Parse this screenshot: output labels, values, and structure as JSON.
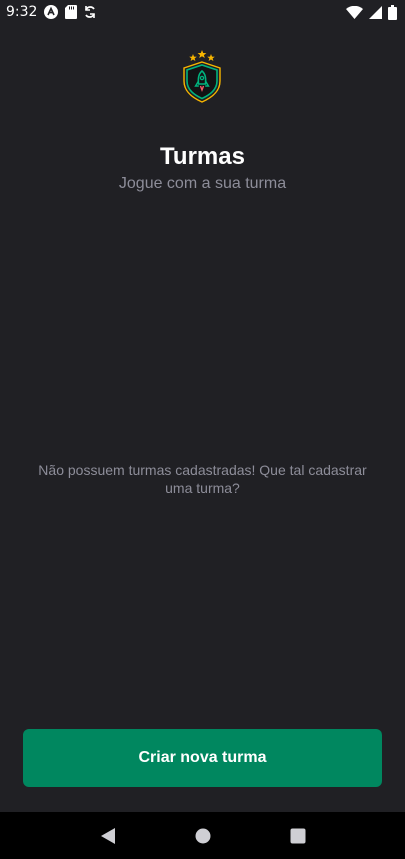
{
  "status_bar": {
    "time": "9:32",
    "icons_left": [
      "app-a-icon",
      "sd-card-icon",
      "sync-icon"
    ],
    "icons_right": [
      "wifi-icon",
      "signal-icon",
      "battery-icon"
    ]
  },
  "header": {
    "logo_icon": "rocket-shield-logo",
    "title": "Turmas",
    "subtitle": "Jogue com a sua turma"
  },
  "list": {
    "empty_message": "Não possuem turmas cadastradas! Que tal cadastrar uma turma?"
  },
  "actions": {
    "create_label": "Criar nova turma"
  },
  "nav_bar": {
    "icons": [
      "back-icon",
      "home-icon",
      "recents-icon"
    ]
  },
  "colors": {
    "background": "#202024",
    "primary": "#00875F",
    "text": "#FFFFFF",
    "muted": "#8D8D99"
  }
}
